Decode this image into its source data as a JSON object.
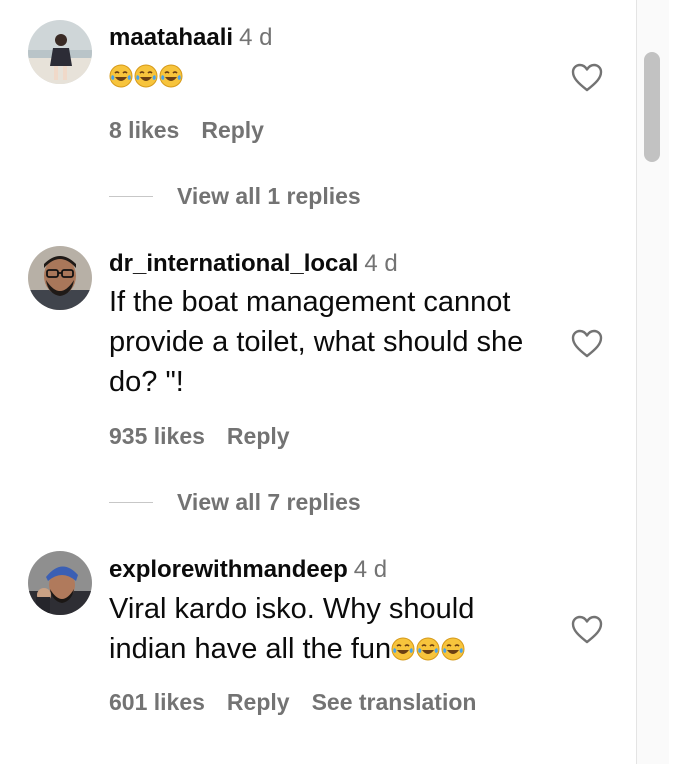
{
  "comments": [
    {
      "username": "maatahaali",
      "time": "4 d",
      "text": "",
      "trailing_emoji_count": 3,
      "emoji_icon": "face-with-tears-of-joy",
      "likes": "8 likes",
      "reply": "Reply",
      "view_replies": "View all 1 replies"
    },
    {
      "username": "dr_international_local",
      "time": "4 d",
      "text": "If the boat management cannot provide a toilet, what should she do? \"!",
      "likes": "935 likes",
      "reply": "Reply",
      "view_replies": "View all 7 replies"
    },
    {
      "username": "explorewithmandeep",
      "time": "4 d",
      "text": "Viral kardo isko. Why should indian have all the fun",
      "trailing_emoji_count": 3,
      "emoji_icon": "face-with-tears-of-joy",
      "likes": "601 likes",
      "reply": "Reply",
      "see_translation": "See translation"
    }
  ],
  "icons": {
    "like": "heart-outline-icon"
  },
  "colors": {
    "secondary_text": "#737373",
    "primary_text": "#0b0b0b",
    "scrollbar_thumb": "#c2c2c2",
    "emoji_face": "#f7c43c",
    "emoji_tears": "#4aa3e8"
  }
}
